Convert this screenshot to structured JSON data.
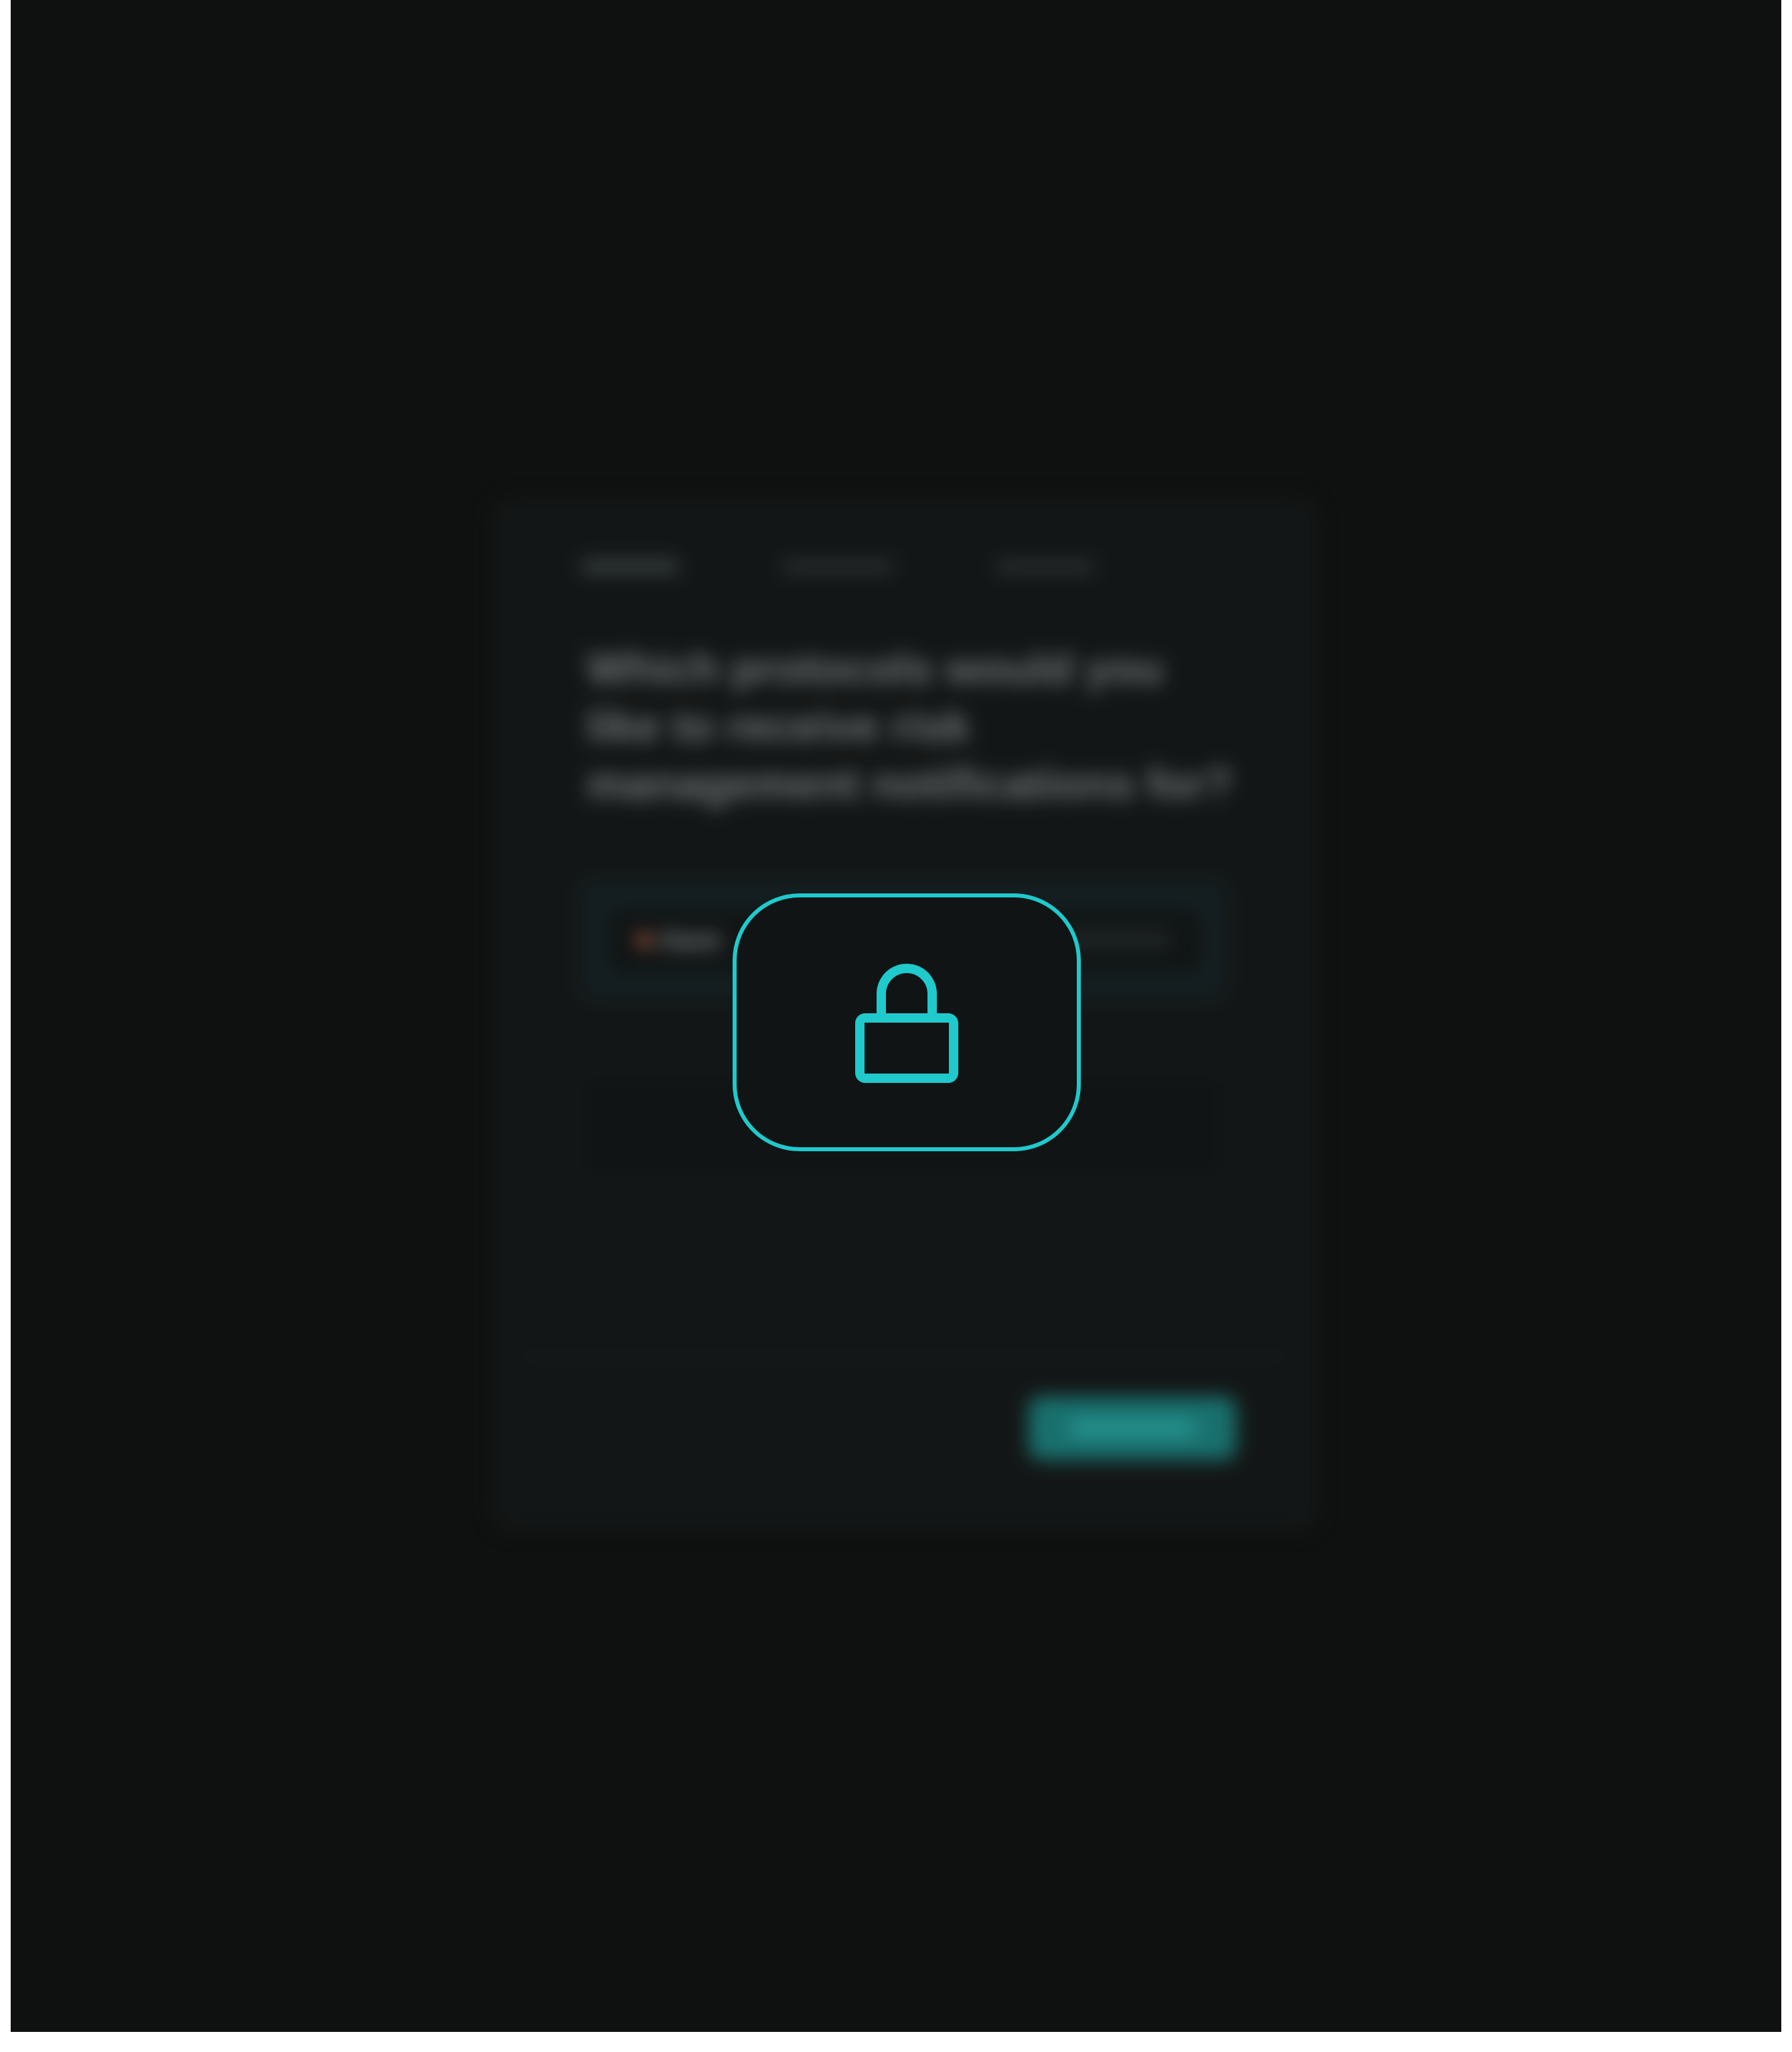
{
  "modal": {
    "question": "Which protocols would you like to receive risk management notifications for?",
    "selected_option": "Aave"
  },
  "overlay": {
    "icon": "lock-icon",
    "accent_color": "#1fc9cc"
  },
  "colors": {
    "background": "#0f1010",
    "modal_background": "#141717",
    "primary_button": "#1a7b78"
  }
}
